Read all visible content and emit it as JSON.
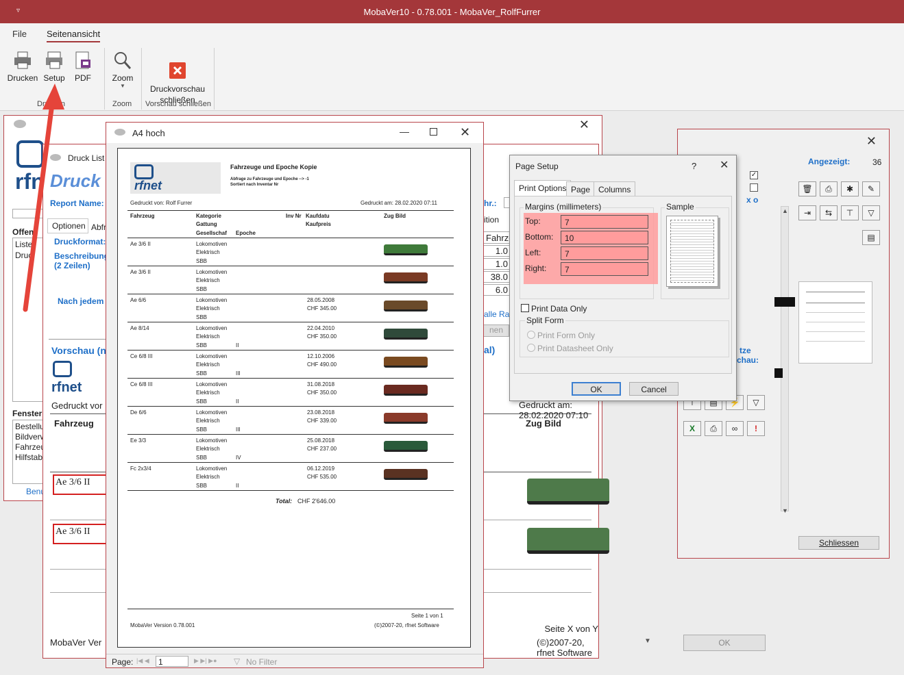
{
  "app": {
    "title": "MobaVer10 - 0.78.001 - MobaVer_RolfFurrer",
    "accent": "#a4373a"
  },
  "ribbon": {
    "tabs": [
      "File",
      "Seitenansicht"
    ],
    "buttons": {
      "print": "Drucken",
      "setup": "Setup",
      "pdf": "PDF",
      "zoom": "Zoom",
      "close_preview": "Druckvorschau\nschließen"
    },
    "groups": {
      "print": "Drucken",
      "zoom": "Zoom",
      "close": "Vorschau schließen"
    }
  },
  "back_window": {
    "logo": "rfnet",
    "druck_list": "Druck List",
    "druck_title": "Druck",
    "report_name": "Report Name:",
    "tab_optionen": "Optionen",
    "tab_abfr": "Abfr",
    "offen": "Offen",
    "list_items": [
      "Liste",
      "Druc"
    ],
    "druckformat": "Druckformat:",
    "beschreibung": "Beschreibung",
    "zwei_zeilen": "(2 Zeilen)",
    "nach_jedem": "Nach jedem",
    "vorschau": "Vorschau (n",
    "gedruckt_von": "Gedruckt vor",
    "fahrzeug": "Fahrzeug",
    "row1": "Ae 3/6 II",
    "row2": "Ae 3/6 II",
    "fenster": "Fenster",
    "fenster_items": [
      "Bestellu",
      "Bildverw",
      "Fahrzeu",
      "Hilfstab"
    ],
    "benu": "Benu",
    "mobaver": "MobaVer Ver",
    "fahrzeug_field": "Fahrze",
    "values": [
      "1.0",
      "1.0",
      "38.0",
      "6.0"
    ],
    "hr": "hr.:",
    "ition": "ition",
    "alle_rah": "alle Rah",
    "nen": "nen",
    "al": "al)",
    "gedruckt_am": "Gedruckt am: 28.02.2020 07:10",
    "zug_bild": "Zug Bild",
    "seite": "Seite X von Y",
    "copyright": "(©)2007-20, rfnet Software"
  },
  "right_window": {
    "angezeigt_label": "Angezeigt:",
    "angezeigt_value": "36",
    "x_label": "x o",
    "tze": "tze",
    "chau": "chau:",
    "schliessen": "Schliessen",
    "ok": "OK"
  },
  "preview": {
    "window_title": "A4 hoch",
    "header_title": "Fahrzeuge und Epoche Kopie",
    "header_sub1": "Abfrage zu Fahrzeuge und Epoche --> -1",
    "header_sub2": "Sortiert nach Inventar Nr",
    "printed_by": "Gedruckt von: Rolf Furrer",
    "printed_at": "Gedruckt am: 28.02.2020 07:11",
    "columns": {
      "fahrzeug": "Fahrzeug",
      "kategorie": "Kategorie",
      "gattung": "Gattung",
      "gesellschaft": "Gesellschaf",
      "epoche": "Epoche",
      "invnr": "Inv Nr",
      "kaufdatum": "Kaufdatu",
      "kaufpreis": "Kaufpreis",
      "zugbild": "Zug Bild"
    },
    "rows": [
      {
        "name": "Ae 3/6 II",
        "kat": "Lokomotiven",
        "gat": "Elektrisch",
        "ges": "SBB",
        "ep": "",
        "date": "",
        "price": "",
        "color": "#3f7a3a"
      },
      {
        "name": "Ae 3/6 II",
        "kat": "Lokomotiven",
        "gat": "Elektrisch",
        "ges": "SBB",
        "ep": "",
        "date": "",
        "price": "",
        "color": "#7a3a24"
      },
      {
        "name": "Ae 6/6",
        "kat": "Lokomotiven",
        "gat": "Elektrisch",
        "ges": "SBB",
        "ep": "",
        "date": "28.05.2008",
        "price": "CHF 345.00",
        "color": "#6a4a2a"
      },
      {
        "name": "Ae 8/14",
        "kat": "Lokomotiven",
        "gat": "Elektrisch",
        "ges": "SBB",
        "ep": "II",
        "date": "22.04.2010",
        "price": "CHF 350.00",
        "color": "#2f4a3a"
      },
      {
        "name": "Ce 6/8 III",
        "kat": "Lokomotiven",
        "gat": "Elektrisch",
        "ges": "SBB",
        "ep": "III",
        "date": "12.10.2006",
        "price": "CHF 490.00",
        "color": "#7a4a20"
      },
      {
        "name": "Ce 6/8 III",
        "kat": "Lokomotiven",
        "gat": "Elektrisch",
        "ges": "SBB",
        "ep": "II",
        "date": "31.08.2018",
        "price": "CHF 350.00",
        "color": "#6a2a20"
      },
      {
        "name": "De 6/6",
        "kat": "Lokomotiven",
        "gat": "Elektrisch",
        "ges": "SBB",
        "ep": "III",
        "date": "23.08.2018",
        "price": "CHF 339.00",
        "color": "#8a3a2a"
      },
      {
        "name": "Ee 3/3",
        "kat": "Lokomotiven",
        "gat": "Elektrisch",
        "ges": "SBB",
        "ep": "IV",
        "date": "25.08.2018",
        "price": "CHF 237.00",
        "color": "#2a5a3a"
      },
      {
        "name": "Fc 2x3/4",
        "kat": "Lokomotiven",
        "gat": "Elektrisch",
        "ges": "SBB",
        "ep": "II",
        "date": "06.12.2019",
        "price": "CHF 535.00",
        "color": "#5a3222"
      }
    ],
    "total_label": "Total:",
    "total_value": "CHF 2'646.00",
    "footer_page": "Seite 1 von 1",
    "footer_version": "MobaVer Version 0.78.001",
    "footer_copy": "(©)2007-20, rfnet Software",
    "nav_label": "Page:",
    "nav_value": "1",
    "no_filter": "No Filter"
  },
  "page_setup": {
    "title": "Page Setup",
    "help": "?",
    "tabs": [
      "Print Options",
      "Page",
      "Columns"
    ],
    "margins_caption": "Margins (millimeters)",
    "sample_caption": "Sample",
    "margins": [
      {
        "label": "Top:",
        "value": "7"
      },
      {
        "label": "Bottom:",
        "value": "10"
      },
      {
        "label": "Left:",
        "value": "7"
      },
      {
        "label": "Right:",
        "value": "7"
      }
    ],
    "print_data_only": "Print Data Only",
    "split_form": "Split Form",
    "print_form_only": "Print Form Only",
    "print_datasheet_only": "Print Datasheet Only",
    "ok": "OK",
    "cancel": "Cancel"
  }
}
